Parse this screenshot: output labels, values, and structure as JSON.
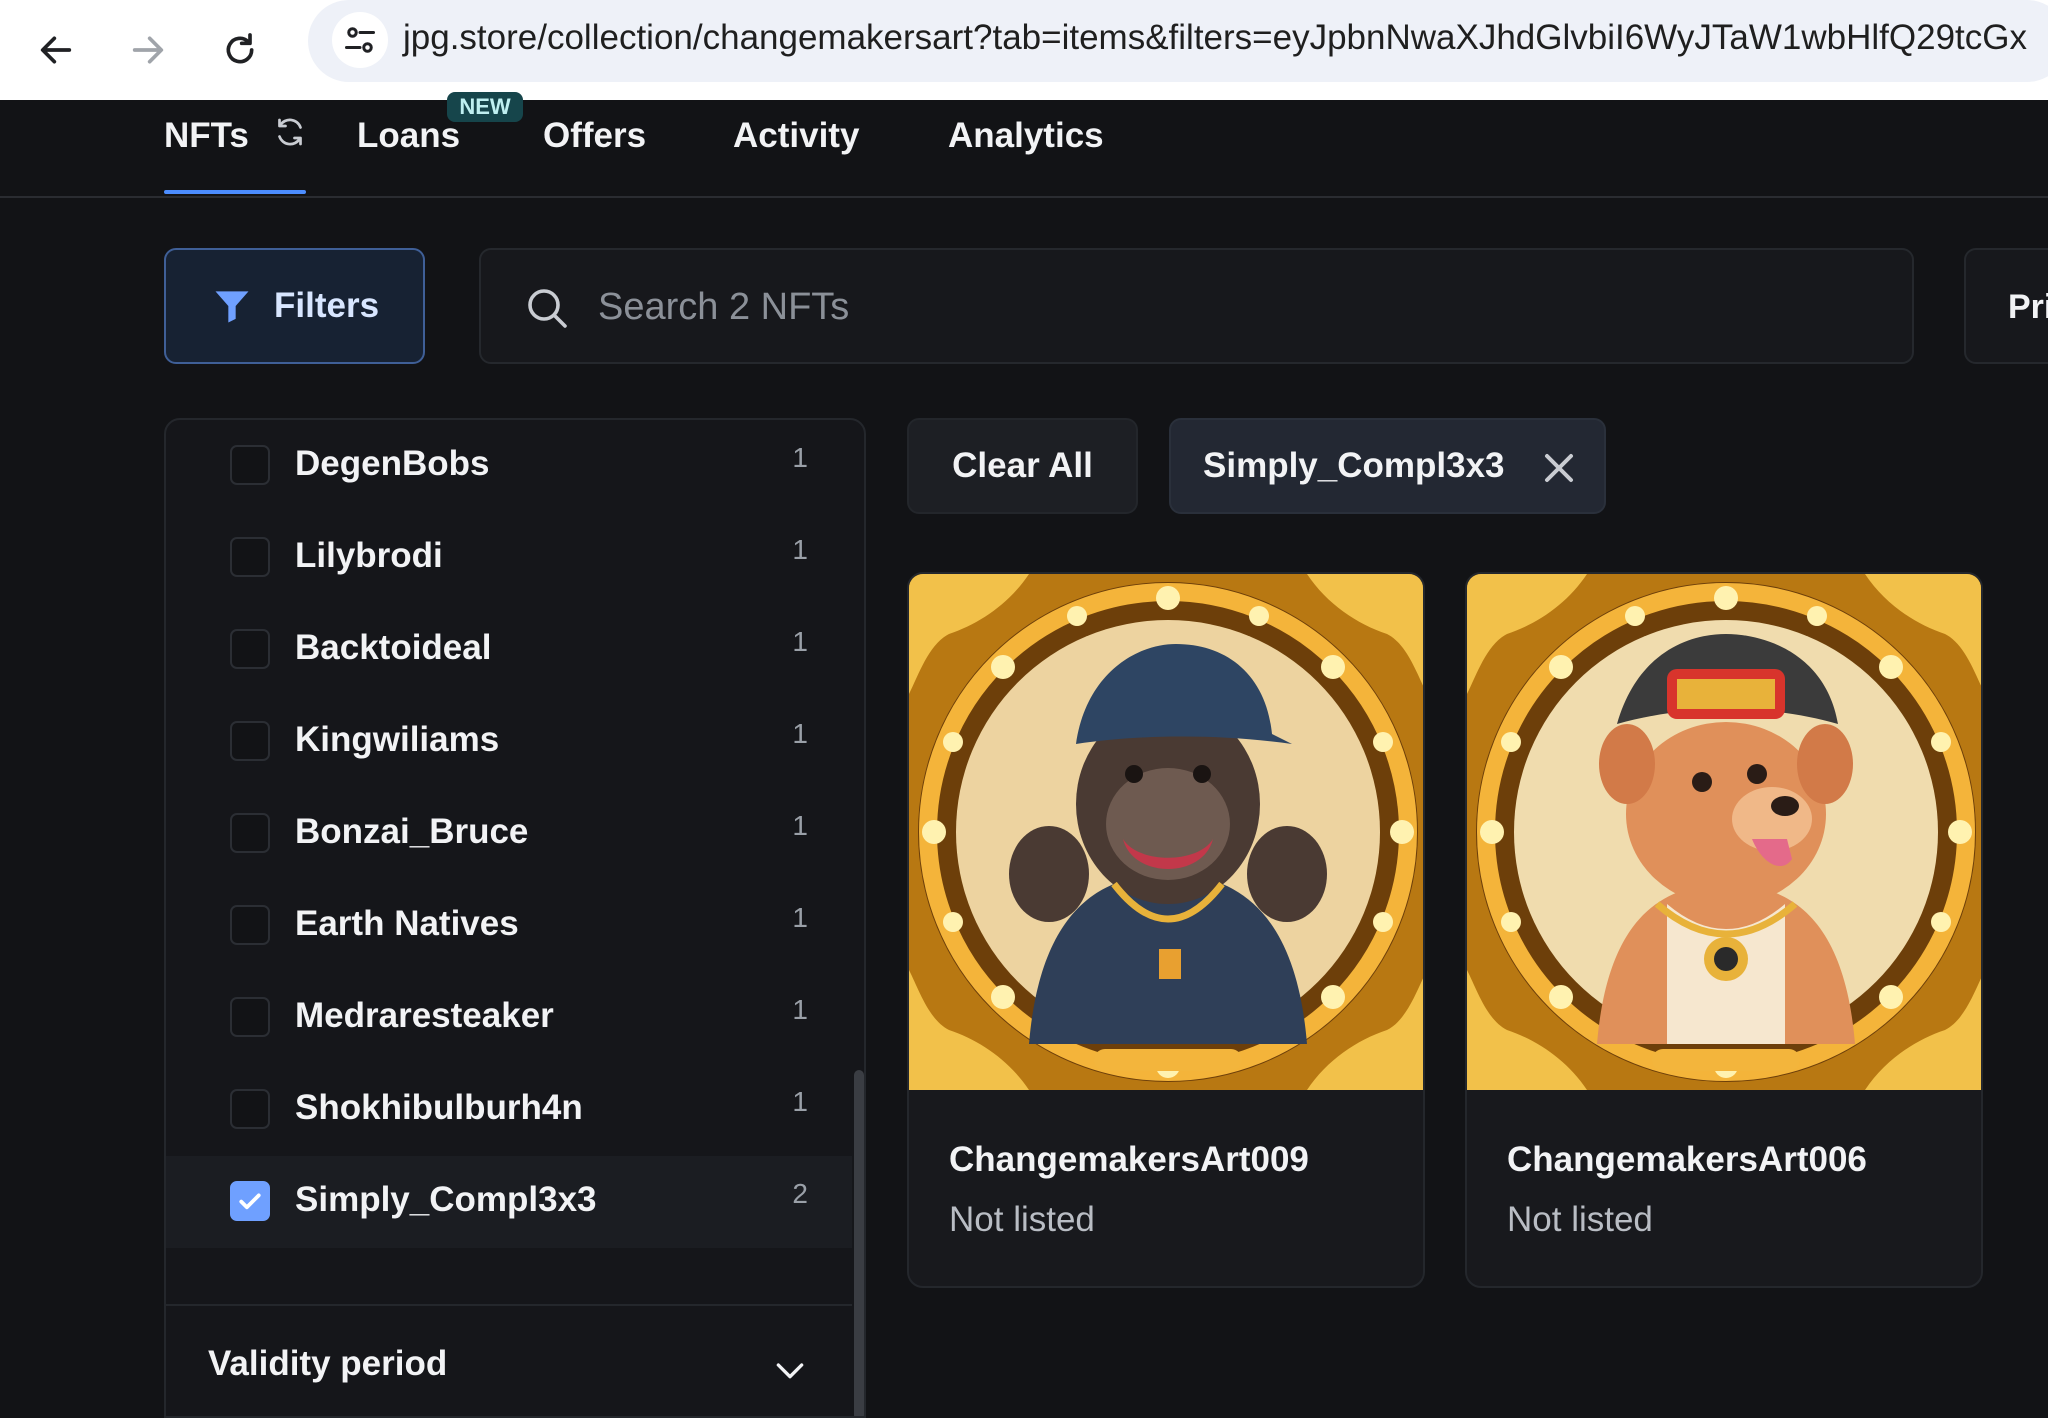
{
  "browser": {
    "url": "jpg.store/collection/changemakersart?tab=items&filters=eyJpbnNwaXJhdGlvbiI6WyJTaW1wbHlfQ29tcGx"
  },
  "tabs": [
    {
      "label": "NFTs"
    },
    {
      "label": "Loans",
      "badge": "NEW"
    },
    {
      "label": "Offers"
    },
    {
      "label": "Activity"
    },
    {
      "label": "Analytics"
    }
  ],
  "filters_button": {
    "label": "Filters"
  },
  "search": {
    "placeholder": "Search 2 NFTs"
  },
  "sort_button": {
    "label": "Pri"
  },
  "sidebar": {
    "items": [
      {
        "label": "DegenBobs",
        "count": "1",
        "checked": false
      },
      {
        "label": "Lilybrodi",
        "count": "1",
        "checked": false
      },
      {
        "label": "Backtoideal",
        "count": "1",
        "checked": false
      },
      {
        "label": "Kingwiliams",
        "count": "1",
        "checked": false
      },
      {
        "label": "Bonzai_Bruce",
        "count": "1",
        "checked": false
      },
      {
        "label": "Earth Natives",
        "count": "1",
        "checked": false
      },
      {
        "label": "Medraresteaker",
        "count": "1",
        "checked": false
      },
      {
        "label": "Shokhibulburh4n",
        "count": "1",
        "checked": false
      },
      {
        "label": "Simply_Compl3x3",
        "count": "2",
        "checked": true
      }
    ],
    "section": {
      "label": "Validity period"
    }
  },
  "chips": {
    "clear_label": "Clear All",
    "active_label": "Simply_Compl3x3"
  },
  "cards": [
    {
      "name": "ChangemakersArt009",
      "status": "Not listed",
      "subject": "gorilla-art"
    },
    {
      "name": "ChangemakersArt006",
      "status": "Not listed",
      "subject": "dog-art"
    }
  ],
  "colors": {
    "background": "#121316",
    "accent": "#4c8dff",
    "checkbox_checked": "#6fa0ff",
    "frame_gold": "#d79a1e"
  }
}
